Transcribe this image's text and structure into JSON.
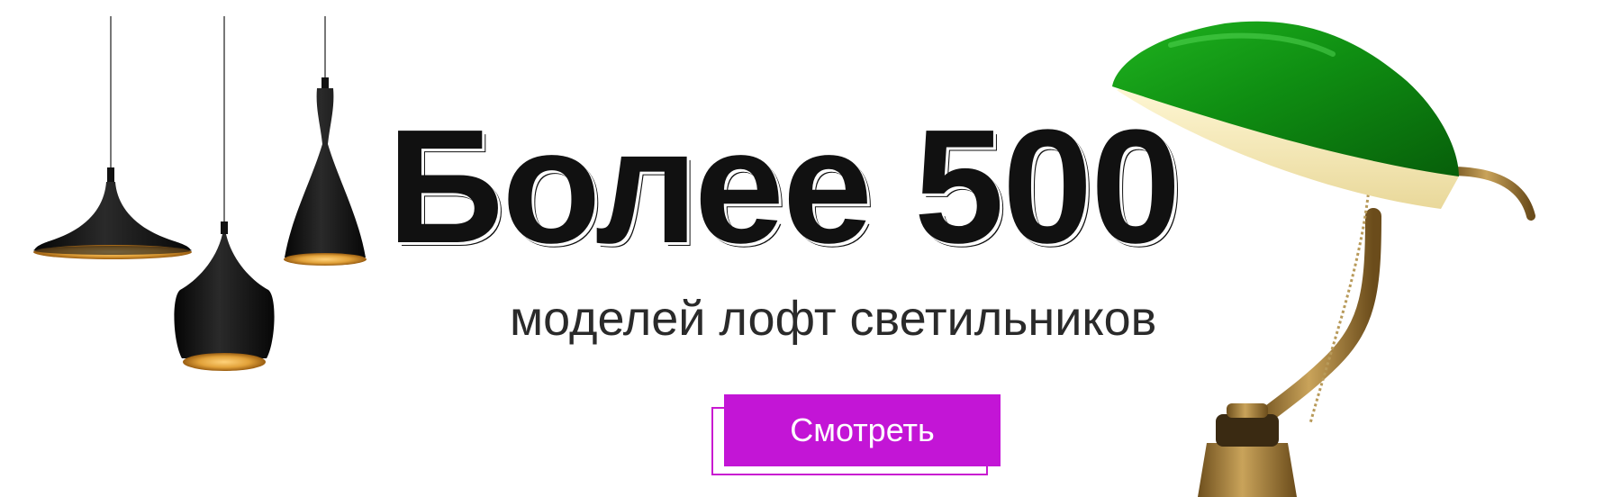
{
  "banner": {
    "headline": "Более 500",
    "subtitle": "моделей лофт светильников",
    "cta_label": "Смотреть"
  },
  "colors": {
    "accent": "#c315d6",
    "text_dark": "#111111",
    "shade_green": "#0e8a12",
    "lamp_black": "#151515",
    "lamp_gold": "#d9962a",
    "brass": "#a8823f"
  },
  "icons": [
    "pendant-lamp-icon",
    "bankers-lamp-icon"
  ]
}
